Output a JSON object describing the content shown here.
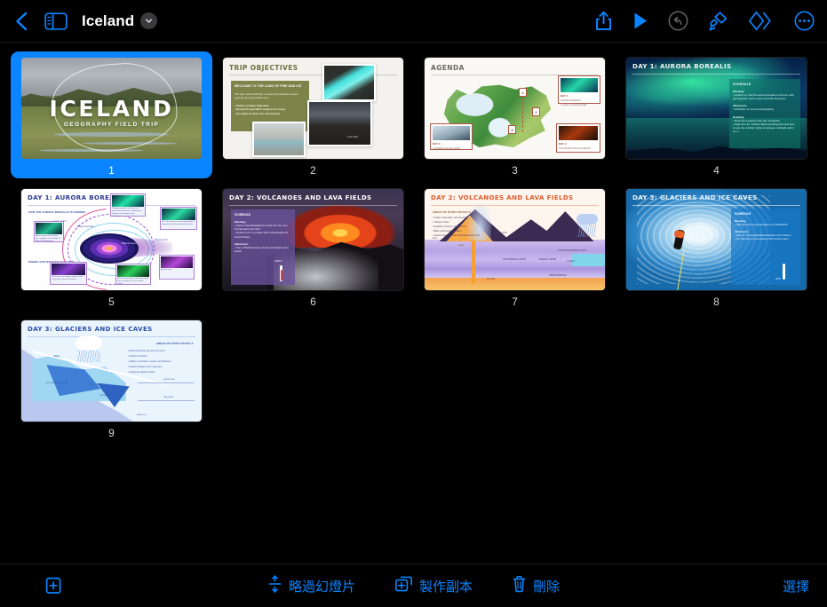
{
  "toolbar": {
    "back_icon": "chevron-left-icon",
    "sidebar_icon": "sidebar-toggle-icon",
    "document_title": "Iceland",
    "title_chevron_icon": "chevron-down-icon",
    "actions": [
      {
        "name": "share-button",
        "icon": "share-icon",
        "enabled": true
      },
      {
        "name": "play-button",
        "icon": "play-icon",
        "enabled": true
      },
      {
        "name": "undo-button",
        "icon": "undo-icon",
        "enabled": false
      },
      {
        "name": "format-button",
        "icon": "paintbrush-icon",
        "enabled": true
      },
      {
        "name": "animate-button",
        "icon": "animate-diamonds-icon",
        "enabled": true
      },
      {
        "name": "more-button",
        "icon": "ellipsis-circle-icon",
        "enabled": true
      }
    ]
  },
  "bottom_toolbar": {
    "add_slide_icon": "add-slide-icon",
    "skip_slide_icon": "skip-slide-icon",
    "skip_slide_label": "略過幻燈片",
    "duplicate_icon": "duplicate-icon",
    "duplicate_label": "製作副本",
    "delete_icon": "trash-icon",
    "delete_label": "刪除",
    "select_label": "選擇"
  },
  "colors": {
    "accent": "#0a84ff",
    "background": "#000000",
    "selected_slide": "#0a84ff",
    "disabled_icon": "#636366"
  },
  "slides": [
    {
      "number": "1",
      "selected": true,
      "kind": "title-photo",
      "title": "ICELAND",
      "subtitle": "GEOGRAPHY FIELD TRIP"
    },
    {
      "number": "2",
      "selected": false,
      "kind": "objectives",
      "title": "TRIP OBJECTIVES",
      "box_heading": "WELCOME TO THE LAND OF FIRE AND ICE",
      "box_paragraph": "The aim of this field trip is exploring Iceland's unique geology and geography are:",
      "bullets": [
        "• Gather primary field data",
        "• Research specialist subject for essay",
        "• Use data as basis for coursework"
      ],
      "photo_caption": "Lava Fields"
    },
    {
      "number": "3",
      "selected": false,
      "kind": "agenda-map",
      "title": "AGENDA",
      "markers": [
        "1",
        "2",
        "3"
      ],
      "cards": [
        {
          "label": "DAY 1",
          "sub": "AURORA BOREALIS",
          "bullets": [
            "• Lecture on aurora borealis",
            "• Time-lapse exhibit",
            "• Evening of northern lights"
          ]
        },
        {
          "label": "DAY 2",
          "sub": "VOLCANOES AND LAVA FIELDS",
          "bullets": [
            "• Fagradalsfjall lava field",
            "• Tour of Bárðarbunga volcano",
            "• Black sand beach"
          ]
        },
        {
          "label": "DAY 3",
          "sub": "GLACIERS AND ICE CAVES",
          "bullets": [
            "• Sail across the glacier lagoon",
            "• Hike on Eyjafjallajökull glacier"
          ]
        }
      ]
    },
    {
      "number": "4",
      "selected": false,
      "kind": "aurora-photo",
      "title": "DAY 1: AURORA BOREALIS",
      "schedule_heading": "SCHEDULE",
      "blocks": [
        {
          "time": "Morning:",
          "lines": [
            "• Lecture on how the aurora borealis is formed, with geomagnetic storm expert Jennifer Sorenson."
          ]
        },
        {
          "time": "Afternoon:",
          "lines": [
            "• Exhibition on aurora photography"
          ]
        },
        {
          "time": "Evening:",
          "lines": [
            "• Drive from Akureyri into the mountains",
            "• Night tour for northern lights spotting (the best time to see the northern lights is between midnight and 2 a.m.)"
          ]
        }
      ]
    },
    {
      "number": "5",
      "selected": false,
      "kind": "aurora-diagram",
      "title": "DAY 1: AURORA BOREALIS",
      "section_a": "HOW THE AURORA BOREALIS IS FORMED",
      "section_b": "WHERE AND WHAT TO LOOK FOR",
      "labels": [
        "Solar wind",
        "Magnetosheath",
        "Bow shock",
        "Magnetopause",
        "Plasma sheet",
        "Magnetotail",
        "Auroral ovals"
      ],
      "captions": [
        "Charged particles from the sun stream toward Earth, colliding with oxygen and nitrogen in the atmosphere.",
        "The solar wind is carried along Earth's magnetic field lines toward the poles.",
        "Aurora green colors come from oxygen at an altitude of about 100 kilometres.",
        "Collisions with nitrogen produce blue and purple auroral emissions.",
        "Best viewed under a dark sky, away from city lights, on clear winter nights."
      ]
    },
    {
      "number": "6",
      "selected": false,
      "kind": "volcano-photo",
      "title": "DAY 2: VOLCANOES AND LAVA FIELDS",
      "schedule_heading": "SCHEDULE",
      "blocks": [
        {
          "time": "Morning:",
          "lines": [
            "• Visit to Fagradalsfjall lava field and the new Nornahraun lava field",
            "• Guided tour of a crater with volcanologist Dr. Grant Phelps"
          ]
        },
        {
          "time": "Afternoon:",
          "lines": [
            "• Trip to Bárðarbunga volcano and black sand beach"
          ]
        }
      ],
      "temperature": "1000°F"
    },
    {
      "number": "7",
      "selected": false,
      "kind": "volcano-diagram",
      "title": "DAY 2: VOLCANOES AND LAVA FIELDS",
      "section_heading": "AREAS OF STUDY ON DAY 2:",
      "bullets": [
        "• Craters, lava tubes, and lava fields",
        "• Volcanic matter",
        "• Eruptions, fissures, and structure",
        "• Black sand beach formation",
        "• Impacts lava fields and volcanoes have on the land"
      ],
      "labels": [
        "ASH CLOUD",
        "LAVA",
        "CONVERGENT",
        "CONTINENTAL CRUST",
        "OCEANIC CRUST",
        "SUBDUCTION",
        "OCEAN",
        "MAGMA",
        "UPPER MANTLE",
        "VOLCANIC RIDGE ACTIVITY",
        "SEA LEVEL RISE"
      ]
    },
    {
      "number": "8",
      "selected": false,
      "kind": "glacier-photo",
      "title": "DAY 3: GLACIERS AND ICE CAVES",
      "schedule_heading": "SCHEDULE",
      "blocks": [
        {
          "time": "Morning:",
          "lines": [
            "• Sail across the glacial lagoon of Jökulsárlón"
          ]
        },
        {
          "time": "Afternoon:",
          "lines": [
            "• Hike on the Eyjafjallajökull glacier and volcano",
            "• Ice climbing demonstration with Kevin Angel"
          ]
        }
      ],
      "temperature": "32°F"
    },
    {
      "number": "9",
      "selected": false,
      "kind": "glacier-diagram",
      "title": "DAY 3: GLACIERS AND ICE CAVES",
      "section_heading": "AREAS OF STUDY ON DAY 3:",
      "bullets": [
        "• Determining the age of an ice core",
        "• Glacier formation",
        "• Valleys, crevasses, cirques, and fissures",
        "• Glacier behavior and movement",
        "• Impact on adjacent lands"
      ],
      "labels": [
        "SNOW",
        "ACCUMULATION ZONE",
        "SNOW LINE",
        "CREVASSES",
        "SNOW LINE",
        "SEA LEVEL",
        "BEDROCK"
      ]
    }
  ]
}
